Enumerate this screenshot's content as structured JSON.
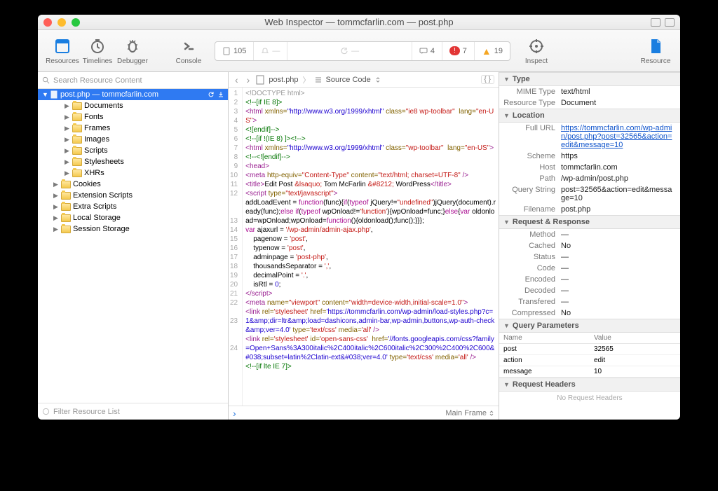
{
  "window": {
    "title": "Web Inspector — tommcfarlin.com — post.php"
  },
  "toolbar": {
    "resources": "Resources",
    "timelines": "Timelines",
    "debugger": "Debugger",
    "console": "Console",
    "inspect": "Inspect",
    "resource": "Resource"
  },
  "statusbar": {
    "count": "105",
    "comments": "4",
    "errors": "7",
    "warnings": "19"
  },
  "sidebar": {
    "search_placeholder": "Search Resource Content",
    "filter_placeholder": "Filter Resource List",
    "root": "post.php — tommcfarlin.com",
    "folders": [
      "Documents",
      "Fonts",
      "Frames",
      "Images",
      "Scripts",
      "Stylesheets",
      "XHRs",
      "Cookies",
      "Extension Scripts",
      "Extra Scripts",
      "Local Storage",
      "Session Storage"
    ]
  },
  "crumb": {
    "file": "post.php",
    "view": "Source Code"
  },
  "footer": {
    "main_frame": "Main Frame"
  },
  "details": {
    "type_h": "Type",
    "mime_k": "MIME Type",
    "mime_v": "text/html",
    "restype_k": "Resource Type",
    "restype_v": "Document",
    "location_h": "Location",
    "fullurl_k": "Full URL",
    "fullurl_v": "https://tommcfarlin.com/wp-admin/post.php?post=32565&action=edit&message=10",
    "scheme_k": "Scheme",
    "scheme_v": "https",
    "host_k": "Host",
    "host_v": "tommcfarlin.com",
    "path_k": "Path",
    "path_v": "/wp-admin/post.php",
    "qs_k": "Query String",
    "qs_v": "post=32565&action=edit&message=10",
    "filename_k": "Filename",
    "filename_v": "post.php",
    "rr_h": "Request & Response",
    "method_k": "Method",
    "method_v": "—",
    "cached_k": "Cached",
    "cached_v": "No",
    "status_k": "Status",
    "status_v": "—",
    "code_k": "Code",
    "code_v": "—",
    "encoded_k": "Encoded",
    "encoded_v": "—",
    "decoded_k": "Decoded",
    "decoded_v": "—",
    "transfered_k": "Transfered",
    "transfered_v": "—",
    "compressed_k": "Compressed",
    "compressed_v": "No",
    "qp_h": "Query Parameters",
    "qp_name": "Name",
    "qp_value": "Value",
    "qp": [
      {
        "n": "post",
        "v": "32565"
      },
      {
        "n": "action",
        "v": "edit"
      },
      {
        "n": "message",
        "v": "10"
      }
    ],
    "rh_h": "Request Headers",
    "rh_none": "No Request Headers"
  },
  "code_lines": [
    "1",
    "2",
    "3",
    "4",
    "5",
    "6",
    "7",
    "8",
    "9",
    "10",
    "11",
    "12",
    "",
    "",
    "13",
    "14",
    "15",
    "16",
    "17",
    "18",
    "19",
    "20",
    "21",
    "22",
    "",
    "23",
    "",
    "",
    "24"
  ]
}
